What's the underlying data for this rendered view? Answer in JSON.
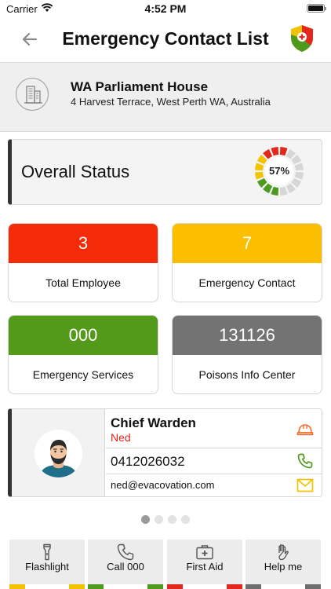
{
  "status_bar": {
    "carrier": "Carrier",
    "time": "4:52 PM"
  },
  "header": {
    "title": "Emergency Contact List",
    "back_icon": "arrow-left-icon",
    "logo": "app-logo-shield-icon"
  },
  "location": {
    "name": "WA Parliament House",
    "address": "4 Harvest Terrace, West Perth WA, Australia",
    "icon": "building-icon"
  },
  "overall_status": {
    "label": "Overall Status",
    "percent_text": "57%",
    "percent": 57,
    "colors": {
      "low": "#4c9a1f",
      "mid": "#f3c300",
      "high": "#e3271c",
      "empty": "#d6d6d6"
    }
  },
  "stats": [
    {
      "value": "3",
      "label": "Total Employee",
      "color": "#f42b08"
    },
    {
      "value": "7",
      "label": "Emergency Contact",
      "color": "#fbbf00"
    },
    {
      "value": "000",
      "label": "Emergency Services",
      "color": "#549a1a"
    },
    {
      "value": "131126",
      "label": "Poisons Info Center",
      "color": "#737373"
    }
  ],
  "contact": {
    "role": "Chief Warden",
    "name": "Ned",
    "phone": "0412026032",
    "email": "ned@evacovation.com",
    "role_icon": "hard-hat-icon",
    "phone_icon": "phone-icon",
    "email_icon": "envelope-icon"
  },
  "pager": {
    "count": 4,
    "active": 0
  },
  "actions": [
    {
      "label": "Flashlight",
      "icon": "flashlight-icon",
      "color": "#f2c200"
    },
    {
      "label": "Call 000",
      "icon": "phone-icon",
      "color": "#4e9a1c"
    },
    {
      "label": "First Aid",
      "icon": "first-aid-kit-icon",
      "color": "#e3271c"
    },
    {
      "label": "Help me",
      "icon": "raised-hand-icon",
      "color": "#6e6e6e"
    }
  ]
}
